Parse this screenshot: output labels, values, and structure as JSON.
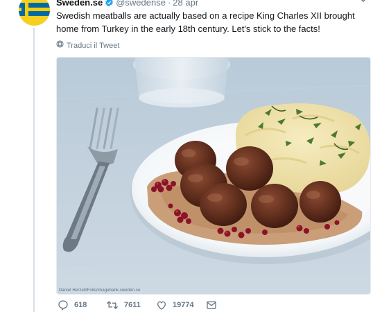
{
  "tweet": {
    "display_name": "Sweden.se",
    "handle": "@swedense",
    "separator": "·",
    "date": "28 apr",
    "text": "Swedish meatballs are actually based on a recipe King Charles XII brought home from Turkey in the early 18th century. Let's stick to the facts!",
    "translate_label": "Traduci il Tweet",
    "image_credit": "Daniel Herzell/Folio/imagebank.sweden.se",
    "image_alt": "Swedish meatballs with mashed potatoes, lingonberries and cream sauce",
    "reply_count": "618",
    "retweet_count": "7611",
    "like_count": "19774",
    "icons": {
      "verified": "verified-badge-icon",
      "caret": "chevron-down-icon",
      "translate": "globe-icon",
      "reply": "reply-icon",
      "retweet": "retweet-icon",
      "like": "heart-icon",
      "message": "envelope-icon"
    },
    "colors": {
      "verified_blue": "#1da1f2",
      "meta_gray": "#657786",
      "flag_blue": "#006aa7",
      "flag_yellow": "#fecc00"
    }
  }
}
